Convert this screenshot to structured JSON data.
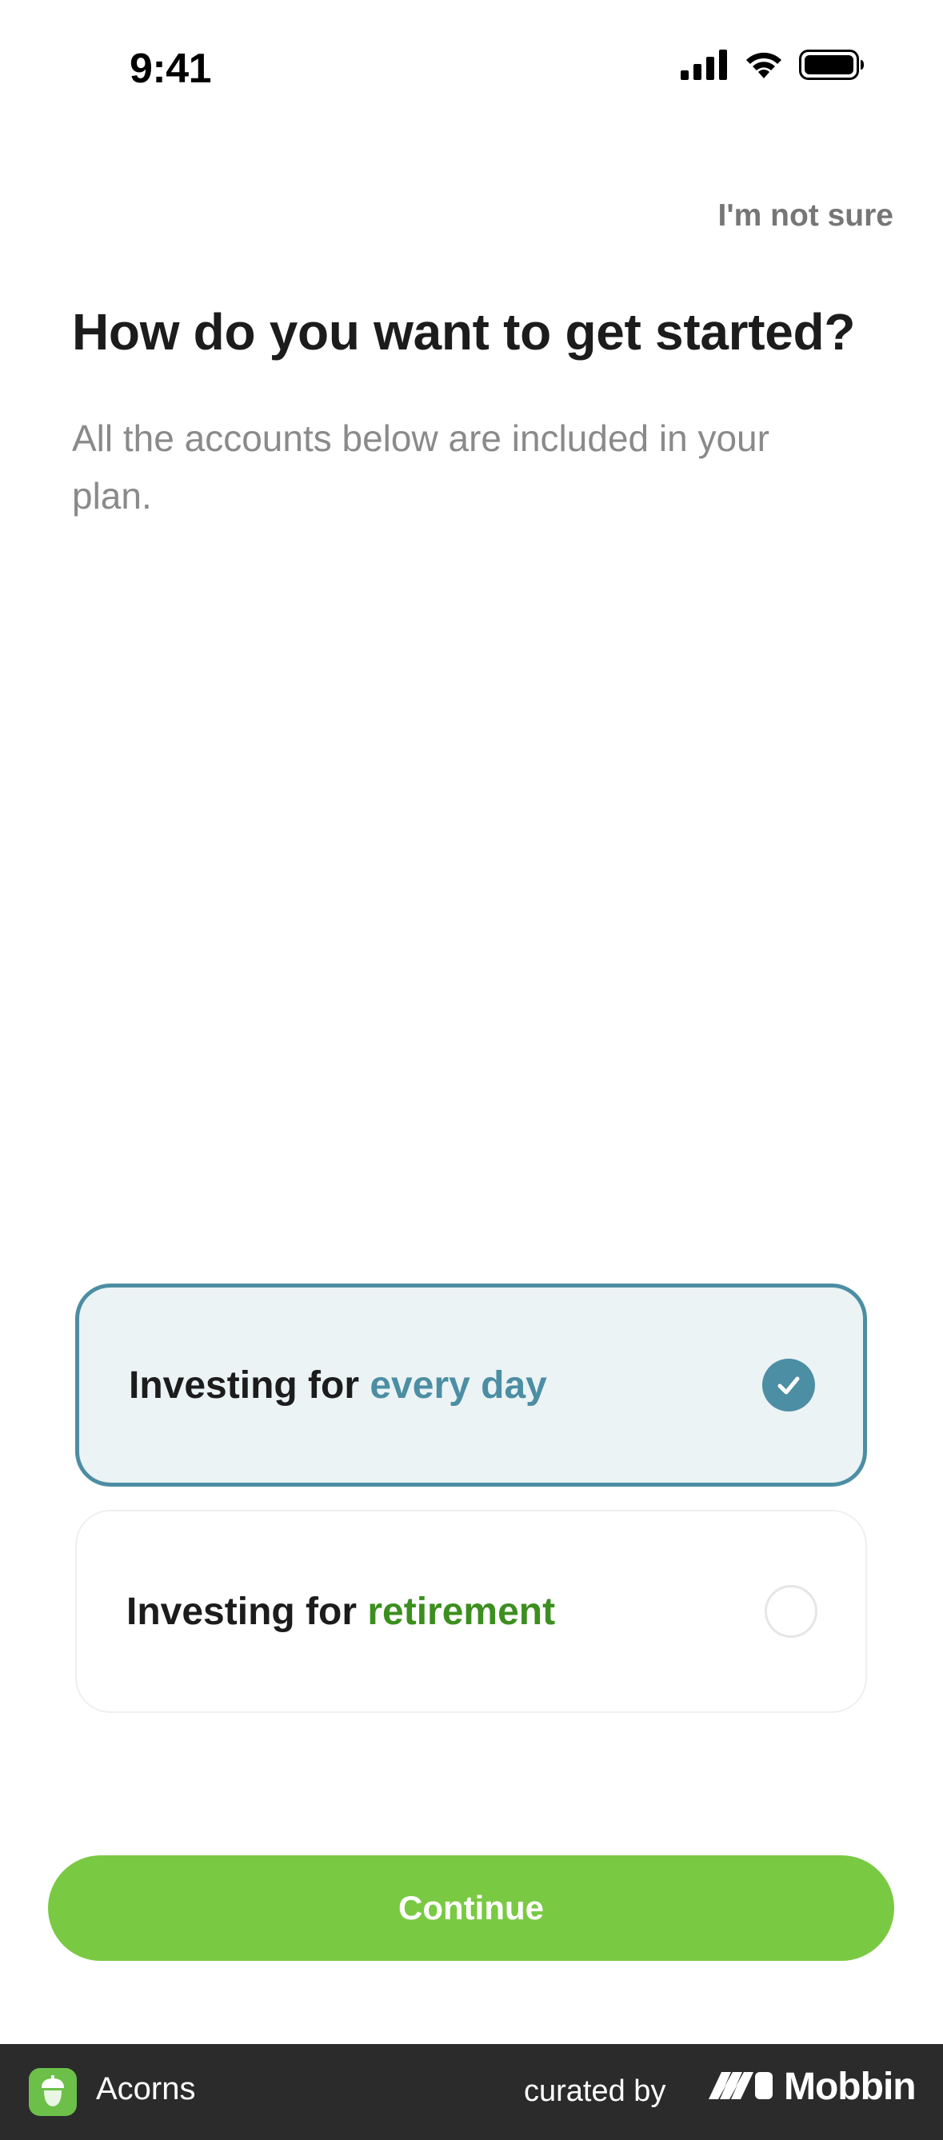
{
  "status_bar": {
    "time": "9:41",
    "icons": [
      "cellular-signal-icon",
      "wifi-icon",
      "battery-icon"
    ]
  },
  "header": {
    "skip_label": "I'm not sure"
  },
  "main": {
    "title": "How do you want to get started?",
    "subtitle": "All the accounts below are included in your plan.",
    "options": [
      {
        "prefix": "Investing for ",
        "highlight": "every day",
        "highlight_color": "#4c8ea3",
        "selected": true
      },
      {
        "prefix": "Investing for ",
        "highlight": "retirement",
        "highlight_color": "#3c8f1f",
        "selected": false
      }
    ]
  },
  "actions": {
    "continue_label": "Continue"
  },
  "footer": {
    "app_name": "Acorns",
    "curated_by": "curated by",
    "brand": "Mobbin"
  },
  "colors": {
    "accent_blue": "#4c8ea3",
    "selected_bg": "#ebf3f5",
    "accent_green": "#3c8f1f",
    "button_green": "#7ac943",
    "footer_bg": "#2b2b2b"
  }
}
